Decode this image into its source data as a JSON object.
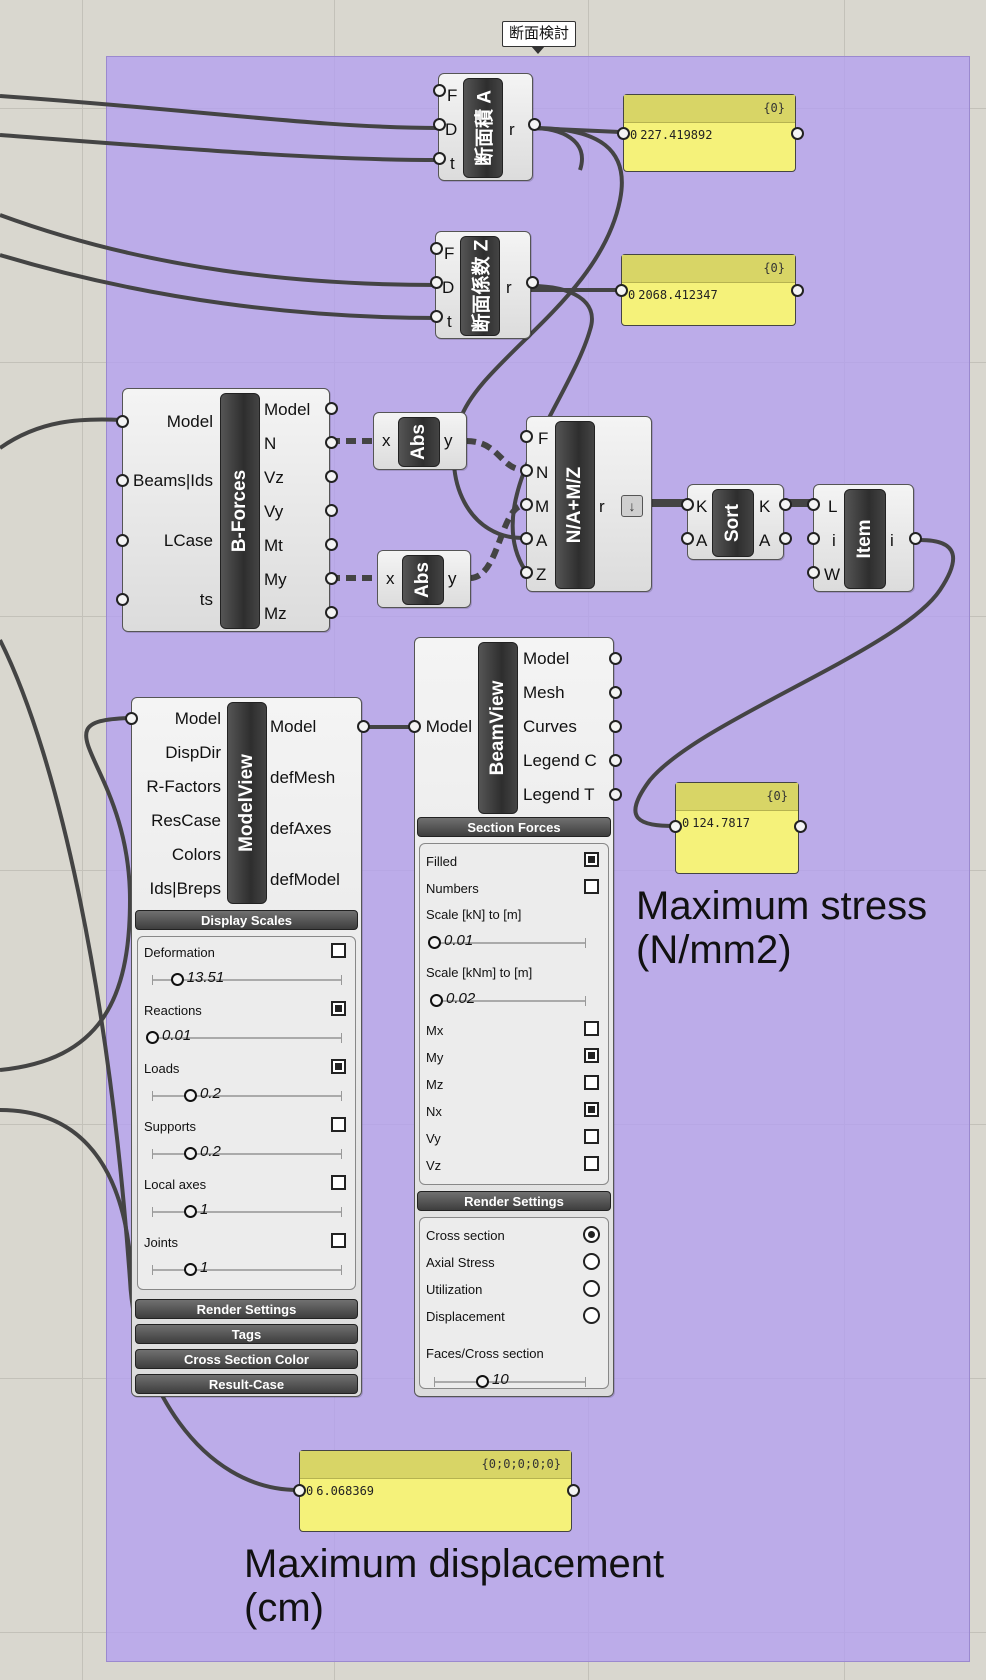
{
  "group": {
    "name": "断面検討"
  },
  "section_area": {
    "name": "断面積 A",
    "inputs": [
      "F",
      "D",
      "t"
    ],
    "outputs": [
      "r"
    ]
  },
  "section_modulus": {
    "name": "断面係数 Z",
    "inputs": [
      "F",
      "D",
      "t"
    ],
    "outputs": [
      "r"
    ]
  },
  "panel_area": {
    "header": "{0}",
    "index": "0",
    "value": "227.419892"
  },
  "panel_modulus": {
    "header": "{0}",
    "index": "0",
    "value": "2068.412347"
  },
  "bforces": {
    "name": "B-Forces",
    "inputs": [
      "Model",
      "Beams|Ids",
      "LCase",
      "ts"
    ],
    "outputs": [
      "Model",
      "N",
      "Vz",
      "Vy",
      "Mt",
      "My",
      "Mz"
    ]
  },
  "abs1": {
    "name": "Abs",
    "input": "x",
    "output": "y"
  },
  "abs2": {
    "name": "Abs",
    "input": "x",
    "output": "y"
  },
  "stress_expr": {
    "name": "N/A+M/Z",
    "inputs": [
      "F",
      "N",
      "M",
      "A",
      "Z"
    ],
    "output": "r",
    "icon": "arrow-down-icon"
  },
  "sort": {
    "name": "Sort",
    "inputs": [
      "K",
      "A"
    ],
    "outputs": [
      "K",
      "A"
    ]
  },
  "item": {
    "name": "Item",
    "inputs": [
      "L",
      "i",
      "W"
    ],
    "output": "i"
  },
  "panel_stress": {
    "header": "{0}",
    "index": "0",
    "value": "124.7817"
  },
  "label_stress": {
    "line1": "Maximum stress",
    "line2": "(N/mm2)"
  },
  "modelview": {
    "name": "ModelView",
    "inputs": [
      "Model",
      "DispDir",
      "R-Factors",
      "ResCase",
      "Colors",
      "Ids|Breps"
    ],
    "outputs": [
      "Model",
      "defMesh",
      "defAxes",
      "defModel"
    ],
    "bar_display": "Display Scales",
    "options": [
      {
        "label": "Deformation",
        "checked": false,
        "value": "13.51",
        "level": 0.13
      },
      {
        "label": "Reactions",
        "checked": true,
        "value": "0.01",
        "level": 0.0
      },
      {
        "label": "Loads",
        "checked": true,
        "value": "0.2",
        "level": 0.2
      },
      {
        "label": "Supports",
        "checked": false,
        "value": "0.2",
        "level": 0.2
      },
      {
        "label": "Local axes",
        "checked": false,
        "value": "1",
        "level": 0.2
      },
      {
        "label": "Joints",
        "checked": false,
        "value": "1",
        "level": 0.2
      }
    ],
    "bars_bottom": [
      "Render Settings",
      "Tags",
      "Cross Section Color",
      "Result-Case"
    ]
  },
  "beamview": {
    "name": "BeamView",
    "input": "Model",
    "outputs": [
      "Model",
      "Mesh",
      "Curves",
      "Legend C",
      "Legend T"
    ],
    "bar_forces": "Section Forces",
    "forces": {
      "filled": {
        "label": "Filled",
        "checked": true
      },
      "numbers": {
        "label": "Numbers",
        "checked": false
      },
      "scale_kn": {
        "label": "Scale [kN] to [m]",
        "value": "0.01"
      },
      "scale_knm": {
        "label": "Scale [kNm] to [m]",
        "value": "0.02"
      },
      "components": [
        {
          "label": "Mx",
          "checked": false
        },
        {
          "label": "My",
          "checked": true
        },
        {
          "label": "Mz",
          "checked": false
        },
        {
          "label": "Nx",
          "checked": true
        },
        {
          "label": "Vy",
          "checked": false
        },
        {
          "label": "Vz",
          "checked": false
        }
      ]
    },
    "bar_render": "Render Settings",
    "render": {
      "modes": [
        {
          "label": "Cross section",
          "selected": true
        },
        {
          "label": "Axial Stress",
          "selected": false
        },
        {
          "label": "Utilization",
          "selected": false
        },
        {
          "label": "Displacement",
          "selected": false
        }
      ],
      "faces_label": "Faces/Cross section",
      "faces_value": "10"
    }
  },
  "panel_disp": {
    "header": "{0;0;0;0;0}",
    "index": "0",
    "value": "6.068369"
  },
  "label_disp": {
    "line1": "Maximum displacement",
    "line2": "(cm)"
  }
}
